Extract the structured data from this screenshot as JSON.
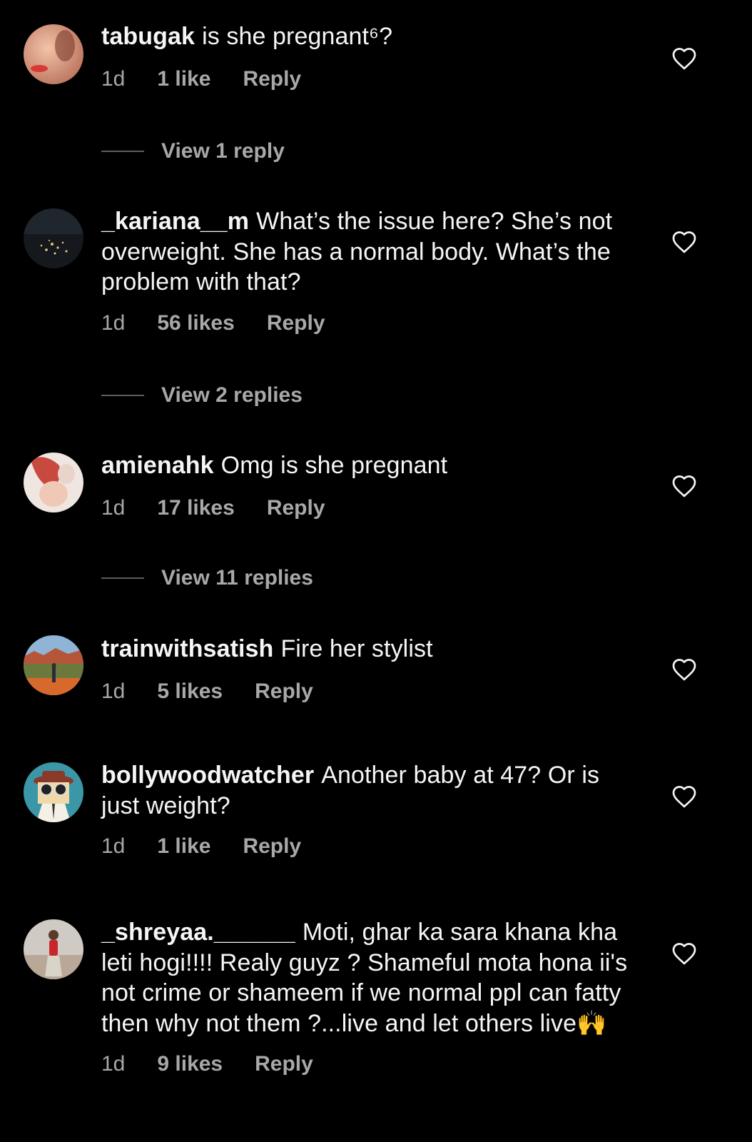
{
  "comments": [
    {
      "username": "tabugak",
      "text": "is she pregnant⁶?",
      "time": "1d",
      "likes": "1 like",
      "reply": "Reply",
      "view_replies": "View 1 reply",
      "avatar_icon": "profile-photo-woman-red-lips"
    },
    {
      "username": "_kariana__m",
      "text": "What’s the issue here? She’s not overweight. She has a normal body. What’s the problem with that?",
      "time": "1d",
      "likes": "56 likes",
      "reply": "Reply",
      "view_replies": "View 2 replies",
      "avatar_icon": "profile-photo-night-city"
    },
    {
      "username": "amienahk",
      "text": "Omg is she pregnant",
      "time": "1d",
      "likes": "17 likes",
      "reply": "Reply",
      "view_replies": "View 11 replies",
      "avatar_icon": "profile-photo-woman-with-baby"
    },
    {
      "username": "trainwithsatish",
      "text": "Fire her stylist",
      "time": "1d",
      "likes": "5 likes",
      "reply": "Reply",
      "avatar_icon": "profile-photo-desert-landscape"
    },
    {
      "username": "bollywoodwatcher",
      "text": "Another baby at 47? Or is just weight?",
      "time": "1d",
      "likes": "1 like",
      "reply": "Reply",
      "avatar_icon": "profile-cartoon-spy-binoculars"
    },
    {
      "username": "_shreyaa.______",
      "text": "Moti, ghar ka sara khana kha leti hogi!!!! Realy guyz ? Shameful mota hona ii's not crime or shameem if we normal ppl can fatty then why not them ?...live and let others live🙌",
      "time": "1d",
      "likes": "9 likes",
      "reply": "Reply",
      "avatar_icon": "profile-photo-woman-red-top"
    }
  ],
  "colors": {
    "background": "#000000",
    "primary_text": "#f5f5f5",
    "secondary_text": "#a8a8a8",
    "divider_line": "#5e5e5e"
  },
  "icons": {
    "like": "heart-outline-icon"
  }
}
